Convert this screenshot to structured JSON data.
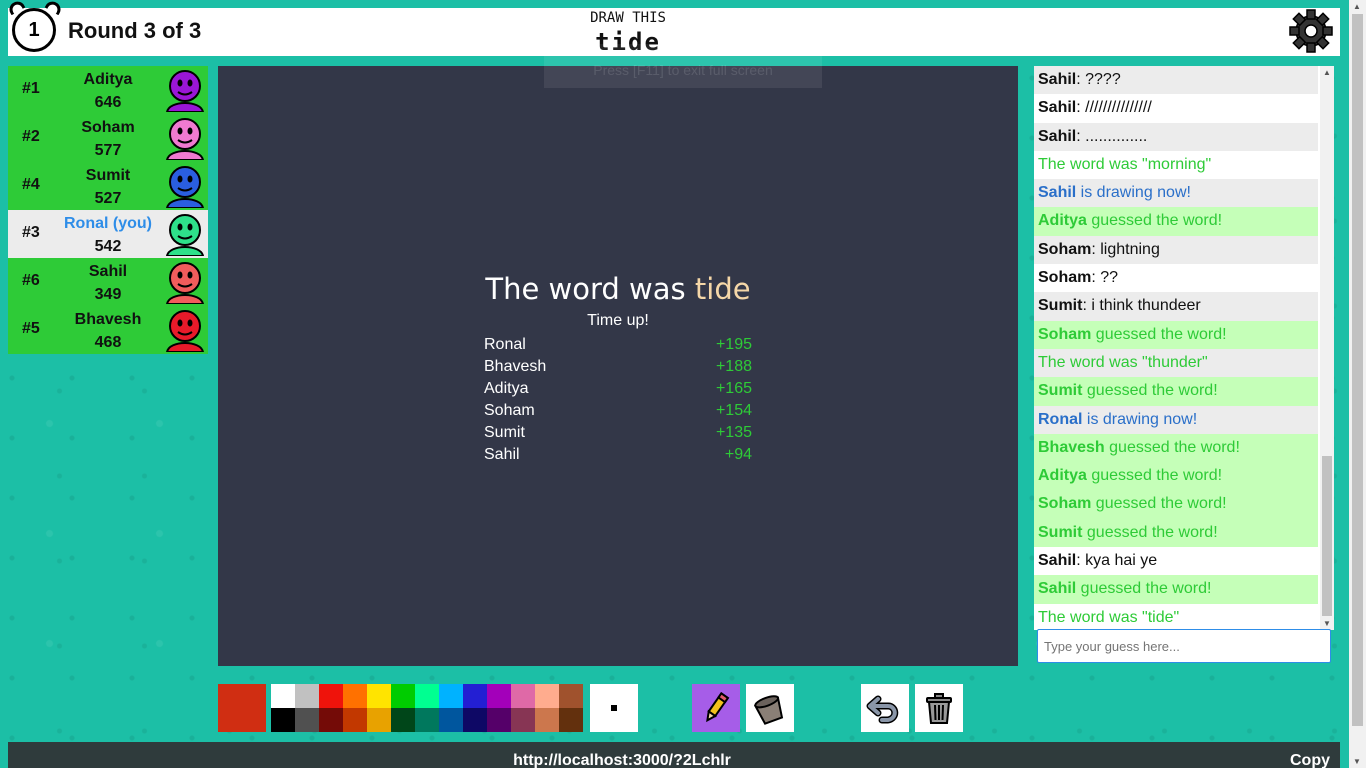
{
  "header": {
    "timer": "1",
    "round_label": "Round 3 of 3",
    "hint_title": "DRAW THIS",
    "word": "tide"
  },
  "players": [
    {
      "rank": "#1",
      "name": "Aditya",
      "score": "646",
      "color": "#9a16d6",
      "you": false
    },
    {
      "rank": "#2",
      "name": "Soham",
      "score": "577",
      "color": "#f07ad0",
      "you": false
    },
    {
      "rank": "#4",
      "name": "Sumit",
      "score": "527",
      "color": "#2a5ee0",
      "you": false
    },
    {
      "rank": "#3",
      "name": "Ronal (you)",
      "score": "542",
      "color": "#2ee08a",
      "you": true
    },
    {
      "rank": "#6",
      "name": "Sahil",
      "score": "349",
      "color": "#f25c5c",
      "you": false
    },
    {
      "rank": "#5",
      "name": "Bhavesh",
      "score": "468",
      "color": "#e81a2a",
      "you": false
    }
  ],
  "results": {
    "title_prefix": "The word was ",
    "word": "tide",
    "reason": "Time up!",
    "rows": [
      {
        "name": "Ronal",
        "points": "+195"
      },
      {
        "name": "Bhavesh",
        "points": "+188"
      },
      {
        "name": "Aditya",
        "points": "+165"
      },
      {
        "name": "Soham",
        "points": "+154"
      },
      {
        "name": "Sumit",
        "points": "+135"
      },
      {
        "name": "Sahil",
        "points": "+94"
      }
    ]
  },
  "toast": "Press [F11] to exit full screen",
  "chat": {
    "messages": [
      {
        "who": "Sahil",
        "text": ": ????",
        "kind": "chat"
      },
      {
        "who": "Sahil",
        "text": ": ///////////////",
        "kind": "chat"
      },
      {
        "who": "Sahil",
        "text": ": ..............",
        "kind": "chat"
      },
      {
        "who": "",
        "text": "The word was \"morning\"",
        "kind": "info"
      },
      {
        "who": "Sahil",
        "text": " is drawing now!",
        "kind": "draw"
      },
      {
        "who": "Aditya",
        "text": " guessed the word!",
        "kind": "guess"
      },
      {
        "who": "Soham",
        "text": ": lightning",
        "kind": "chat"
      },
      {
        "who": "Soham",
        "text": ": ??",
        "kind": "chat"
      },
      {
        "who": "Sumit",
        "text": ": i think thundeer",
        "kind": "chat"
      },
      {
        "who": "Soham",
        "text": " guessed the word!",
        "kind": "guess"
      },
      {
        "who": "",
        "text": "The word was \"thunder\"",
        "kind": "info"
      },
      {
        "who": "Sumit",
        "text": " guessed the word!",
        "kind": "guess"
      },
      {
        "who": "Ronal",
        "text": " is drawing now!",
        "kind": "draw"
      },
      {
        "who": "Bhavesh",
        "text": " guessed the word!",
        "kind": "guess"
      },
      {
        "who": "Aditya",
        "text": " guessed the word!",
        "kind": "guess"
      },
      {
        "who": "Soham",
        "text": " guessed the word!",
        "kind": "guess"
      },
      {
        "who": "Sumit",
        "text": " guessed the word!",
        "kind": "guess"
      },
      {
        "who": "Sahil",
        "text": ": kya hai ye",
        "kind": "chat"
      },
      {
        "who": "Sahil",
        "text": " guessed the word!",
        "kind": "guess"
      },
      {
        "who": "",
        "text": "The word was \"tide\"",
        "kind": "info"
      }
    ],
    "input_placeholder": "Type your guess here..."
  },
  "toolbar": {
    "current_color": "#d02e12",
    "palette_top": [
      "#ffffff",
      "#c1c1c1",
      "#ef130b",
      "#ff7100",
      "#ffe400",
      "#00cc00",
      "#00ff91",
      "#00b2ff",
      "#231fd3",
      "#a300ba",
      "#df69a7",
      "#ffac8e",
      "#a0522d"
    ],
    "palette_bottom": [
      "#000000",
      "#505050",
      "#740b07",
      "#c23800",
      "#e8a200",
      "#004619",
      "#00785d",
      "#00569e",
      "#0e0865",
      "#550069",
      "#873554",
      "#cc774d",
      "#63300d"
    ],
    "tools": [
      "pencil-icon",
      "fill-bucket-icon",
      "undo-icon",
      "trash-icon"
    ]
  },
  "footer": {
    "invite_url": "http://localhost:3000/?2Lchlr",
    "copy_label": "Copy"
  }
}
